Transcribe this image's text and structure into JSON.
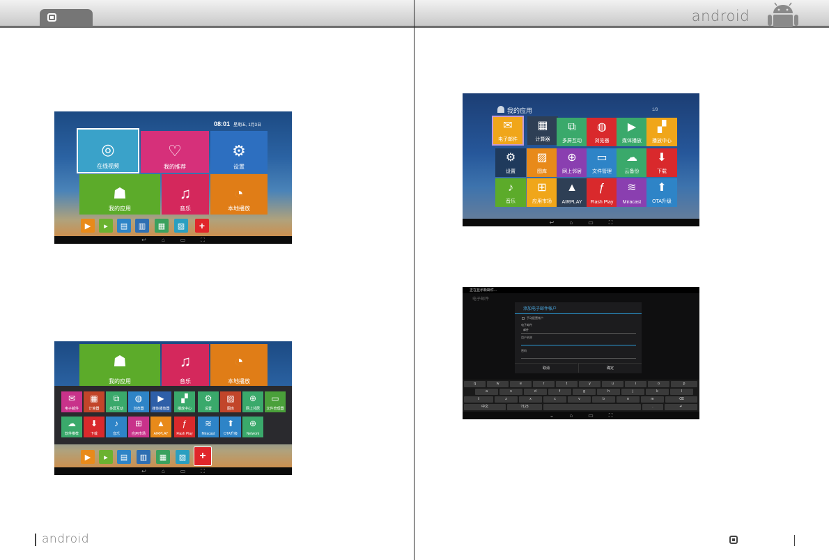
{
  "header": {
    "brand": "android"
  },
  "footer": {
    "brand": "android"
  },
  "home": {
    "clock": "08:01",
    "date": "星期五, 1月3日",
    "tiles": [
      {
        "label": "在线视频",
        "icon": "film-reel-icon",
        "color": "#3aa2c9"
      },
      {
        "label": "我的推荐",
        "icon": "heart-folder-icon",
        "color": "#d6307a"
      },
      {
        "label": "设置",
        "icon": "gear-icon",
        "color": "#2d6fc0"
      },
      {
        "label": "我的应用",
        "icon": "android-icon",
        "color": "#5cab2a"
      },
      {
        "label": "音乐",
        "icon": "music-note-icon",
        "color": "#d4285c"
      },
      {
        "label": "本地播放",
        "icon": "disc-icon",
        "color": "#e07d17"
      }
    ],
    "dock": [
      {
        "icon": "play-icon",
        "color": "#e88a1a"
      },
      {
        "icon": "video-icon",
        "color": "#6bb230"
      },
      {
        "icon": "briefcase-icon",
        "color": "#2e84c7"
      },
      {
        "icon": "printer-icon",
        "color": "#2f6fb2"
      },
      {
        "icon": "calculator-icon",
        "color": "#3aa15e"
      },
      {
        "icon": "picture-icon",
        "color": "#2a9fc0"
      },
      {
        "icon": "plus-icon",
        "color": "#e0262a"
      }
    ]
  },
  "apps_screen": {
    "title": "我的应用",
    "count": "1/3",
    "apps": [
      {
        "label": "电子邮件",
        "icon": "mail-icon",
        "color": "#f0a61a"
      },
      {
        "label": "计算器",
        "icon": "calculator-icon",
        "color": "#2e3f55"
      },
      {
        "label": "多屏互动",
        "icon": "share-screen-icon",
        "color": "#3aa96b"
      },
      {
        "label": "浏览器",
        "icon": "globe-icon",
        "color": "#d9292c"
      },
      {
        "label": "媒体播放",
        "icon": "play-icon",
        "color": "#3aa96b"
      },
      {
        "label": "播放中心",
        "icon": "clapper-icon",
        "color": "#f0a61a"
      },
      {
        "label": "设置",
        "icon": "gear-icon",
        "color": "#1f3a5c"
      },
      {
        "label": "图库",
        "icon": "picture-icon",
        "color": "#e88a1a"
      },
      {
        "label": "网上邻居",
        "icon": "network-icon",
        "color": "#8a3fb0"
      },
      {
        "label": "文件管理",
        "icon": "folder-icon",
        "color": "#2e84c7"
      },
      {
        "label": "云备份",
        "icon": "cloud-icon",
        "color": "#3aa96b"
      },
      {
        "label": "下载",
        "icon": "download-icon",
        "color": "#d9292c"
      },
      {
        "label": "音乐",
        "icon": "music-icon",
        "color": "#5cab2a"
      },
      {
        "label": "应用市场",
        "icon": "store-icon",
        "color": "#f0a61a"
      },
      {
        "label": "AIRPLAY",
        "icon": "airplay-icon",
        "color": "#2e3f55"
      },
      {
        "label": "Flash Play",
        "icon": "flash-icon",
        "color": "#d9292c"
      },
      {
        "label": "Miracast",
        "icon": "wifi-icon",
        "color": "#8a3fb0"
      },
      {
        "label": "OTA升级",
        "icon": "upload-icon",
        "color": "#2e84c7"
      }
    ]
  },
  "launcher_screen": {
    "top_tiles": [
      {
        "label": "我的应用",
        "icon": "android-icon",
        "color": "#5cab2a"
      },
      {
        "label": "音乐",
        "icon": "music-note-icon",
        "color": "#d4285c"
      },
      {
        "label": "本地播放",
        "icon": "disc-icon",
        "color": "#e07d17"
      }
    ],
    "row1": [
      {
        "label": "电子邮件",
        "icon": "mail-icon",
        "color": "#c8328a"
      },
      {
        "label": "计算器",
        "icon": "calculator-icon",
        "color": "#c2452a"
      },
      {
        "label": "多屏互动",
        "icon": "share-screen-icon",
        "color": "#3aa96b"
      },
      {
        "label": "浏览器",
        "icon": "globe-icon",
        "color": "#2e84c7"
      },
      {
        "label": "媒体播放器",
        "icon": "play-icon",
        "color": "#2e5fa8"
      },
      {
        "label": "播放中心",
        "icon": "clapper-icon",
        "color": "#3aa96b"
      },
      {
        "label": "设置",
        "icon": "gear-icon",
        "color": "#3aa96b"
      },
      {
        "label": "图库",
        "icon": "picture-icon",
        "color": "#c2452a"
      },
      {
        "label": "网上邻居",
        "icon": "network-icon",
        "color": "#3aa96b"
      },
      {
        "label": "文件管理器",
        "icon": "folder-icon",
        "color": "#4aa03a"
      }
    ],
    "row2": [
      {
        "label": "软件推荐",
        "icon": "cloud-icon",
        "color": "#3aa96b"
      },
      {
        "label": "下载",
        "icon": "download-icon",
        "color": "#d9292c"
      },
      {
        "label": "音乐",
        "icon": "music-icon",
        "color": "#2e84c7"
      },
      {
        "label": "应用市场",
        "icon": "store-icon",
        "color": "#c8328a"
      },
      {
        "label": "AIRPLAY",
        "icon": "airplay-icon",
        "color": "#e88a1a"
      },
      {
        "label": "Flash Play",
        "icon": "flash-icon",
        "color": "#d9292c"
      },
      {
        "label": "Miracast",
        "icon": "wifi-icon",
        "color": "#2e84c7"
      },
      {
        "label": "OTA升级",
        "icon": "upload-icon",
        "color": "#2e84c7"
      },
      {
        "label": "Network",
        "icon": "network-icon",
        "color": "#3aa96b"
      }
    ]
  },
  "dialog_screen": {
    "status": "正在显示新邮件...",
    "app_title": "电子邮件",
    "dialog_title": "添加电子邮件帐户",
    "checkbox_label": "手动配置帐户",
    "field1_label": "电子邮件",
    "field1_value": "邮件",
    "field2_label": "用户名称",
    "field3_label": "密码",
    "btn_cancel": "取消",
    "btn_ok": "确定",
    "keys_row1": [
      "q",
      "w",
      "e",
      "r",
      "t",
      "y",
      "u",
      "i",
      "o",
      "p"
    ],
    "keys_row2": [
      "a",
      "s",
      "d",
      "f",
      "g",
      "h",
      "j",
      "k",
      "l"
    ],
    "keys_row3": [
      "⇧",
      "z",
      "x",
      "c",
      "v",
      "b",
      "n",
      "m",
      "⌫"
    ],
    "keys_row4": [
      "中文",
      "?123",
      "",
      ".",
      "↵"
    ]
  }
}
